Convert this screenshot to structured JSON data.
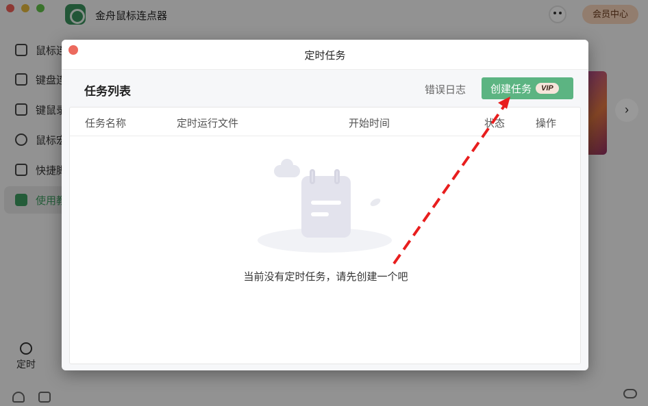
{
  "app": {
    "title": "金舟鼠标连点器",
    "member_button": "会员中心"
  },
  "sidebar": {
    "items": [
      {
        "label": "鼠标连",
        "icon": "click-icon"
      },
      {
        "label": "键盘连",
        "icon": "keyboard-icon"
      },
      {
        "label": "键鼠录",
        "icon": "record-icon"
      },
      {
        "label": "鼠标宏",
        "icon": "mouse-icon"
      },
      {
        "label": "快捷脚",
        "icon": "code-icon"
      },
      {
        "label": "使用教",
        "icon": "book-icon",
        "active": true
      }
    ],
    "timer_label": "定时"
  },
  "modal": {
    "title": "定时任务",
    "toolbar": {
      "title": "任务列表",
      "error_log": "错误日志",
      "create_button": "创建任务",
      "vip_badge": "VIP"
    },
    "table": {
      "headers": [
        "任务名称",
        "定时运行文件",
        "开始时间",
        "状态",
        "操作"
      ]
    },
    "empty_message": "当前没有定时任务，请先创建一个吧"
  },
  "colors": {
    "accent_green": "#5cb482",
    "annotation_red": "#e81e1e"
  }
}
